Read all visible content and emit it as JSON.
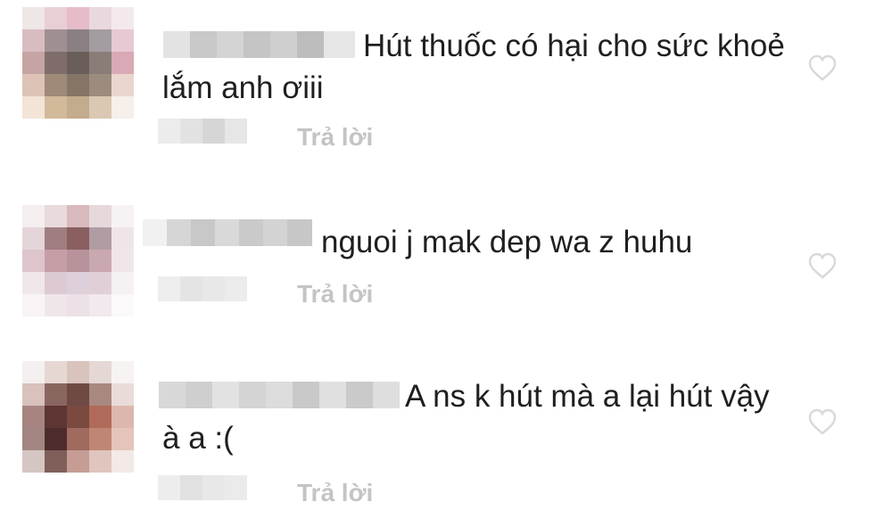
{
  "comments": [
    {
      "text": "Hút thuốc có hại cho sức khoẻ lắm anh ơiii",
      "reply_label": "Trả lời",
      "like_icon": "heart-outline-icon"
    },
    {
      "text": "nguoi j mak dep wa z huhu",
      "reply_label": "Trả lời",
      "like_icon": "heart-outline-icon"
    },
    {
      "text": "A ns k hút mà a lại hút vậy à a :(",
      "reply_label": "Trả lời",
      "like_icon": "heart-outline-icon"
    }
  ],
  "colors": {
    "reply_text": "#c4c4c4",
    "comment_text": "#1f1f1f",
    "heart_outline": "#d9d9d9"
  }
}
